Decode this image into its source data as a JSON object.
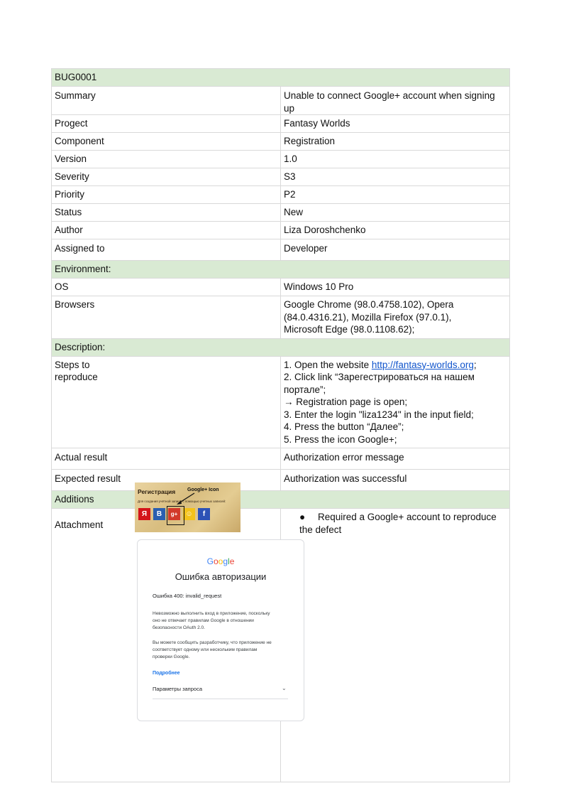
{
  "bug_id": "BUG0001",
  "fields": [
    {
      "label": "Summary",
      "value": "Unable to connect Google+ account when signing up"
    },
    {
      "label": "Progect",
      "value": "Fantasy Worlds"
    },
    {
      "label": "Component",
      "value": "Registration"
    },
    {
      "label": "Version",
      "value": "1.0"
    },
    {
      "label": "Severity",
      "value": "S3"
    },
    {
      "label": "Priority",
      "value": "P2"
    },
    {
      "label": "Status",
      "value": "New"
    },
    {
      "label": "Author",
      "value": "Liza Doroshchenko"
    },
    {
      "label": "Assigned to",
      "value": "Developer"
    }
  ],
  "environment": {
    "section": "Environment:",
    "os_label": "OS",
    "os_value": "Windows 10 Pro",
    "browsers_label": "Browsers",
    "browsers_line1": "Google Chrome (98.0.4758.102), Opera (84.0.4316.21), Mozilla Firefox (97.0.1),",
    "browsers_line2": "Microsoft Edge (98.0.1108.62);"
  },
  "description": {
    "section": "Description:",
    "steps_label_1": "Steps to",
    "steps_label_2": "reproduce",
    "step1_prefix": "1. Open the website ",
    "step1_link": "http://fantasy-worlds.org",
    "step1_suffix": ";",
    "step2": "2. Click link “Зарегестрироваться на нашем портале”;",
    "step2b": "→ Registration page is open;",
    "step3": "3. Enter the login \"liza1234\" in the input field;",
    "step4": "4. Press the button “Далее”;",
    "step5": "5. Press the icon Google+;",
    "actual_label": "Actual result",
    "actual_value": "Authorization error message",
    "expected_label": "Expected result",
    "expected_value": "Authorization was successful"
  },
  "additions": {
    "section": "Additions",
    "attachment_label": "Attachment",
    "bullet": "Required a Google+ account to reproduce the defect",
    "reg_image": {
      "title": "Регистрация",
      "callout": "Google+ Icon",
      "small_text": "Для создания учётной записи с помощью учетных записей:",
      "icons": [
        {
          "glyph": "Я",
          "color": "#d4141a"
        },
        {
          "glyph": "В",
          "color": "#2a5fb0"
        },
        {
          "glyph": "g+",
          "color": "#d23a2a"
        },
        {
          "glyph": "☺",
          "color": "#f3c21b"
        },
        {
          "glyph": "f",
          "color": "#2d52b6"
        }
      ]
    },
    "google_card": {
      "logo": "Google",
      "heading": "Ошибка авторизации",
      "error": "Ошибка 400: invalid_request",
      "para1_l1": "Невозможно выполнить вход в приложение, поскольку",
      "para1_l2": "оно не отвечает правилам Google в отношении",
      "para1_l3": "безопасности OAuth 2.0.",
      "para2_l1": "Вы можете сообщить разработчику, что приложение не",
      "para2_l2": "соответствует одному или нескольким правилам",
      "para2_l3": "проверки Google.",
      "more": "Подробнее",
      "params": "Параметры запроса"
    }
  }
}
